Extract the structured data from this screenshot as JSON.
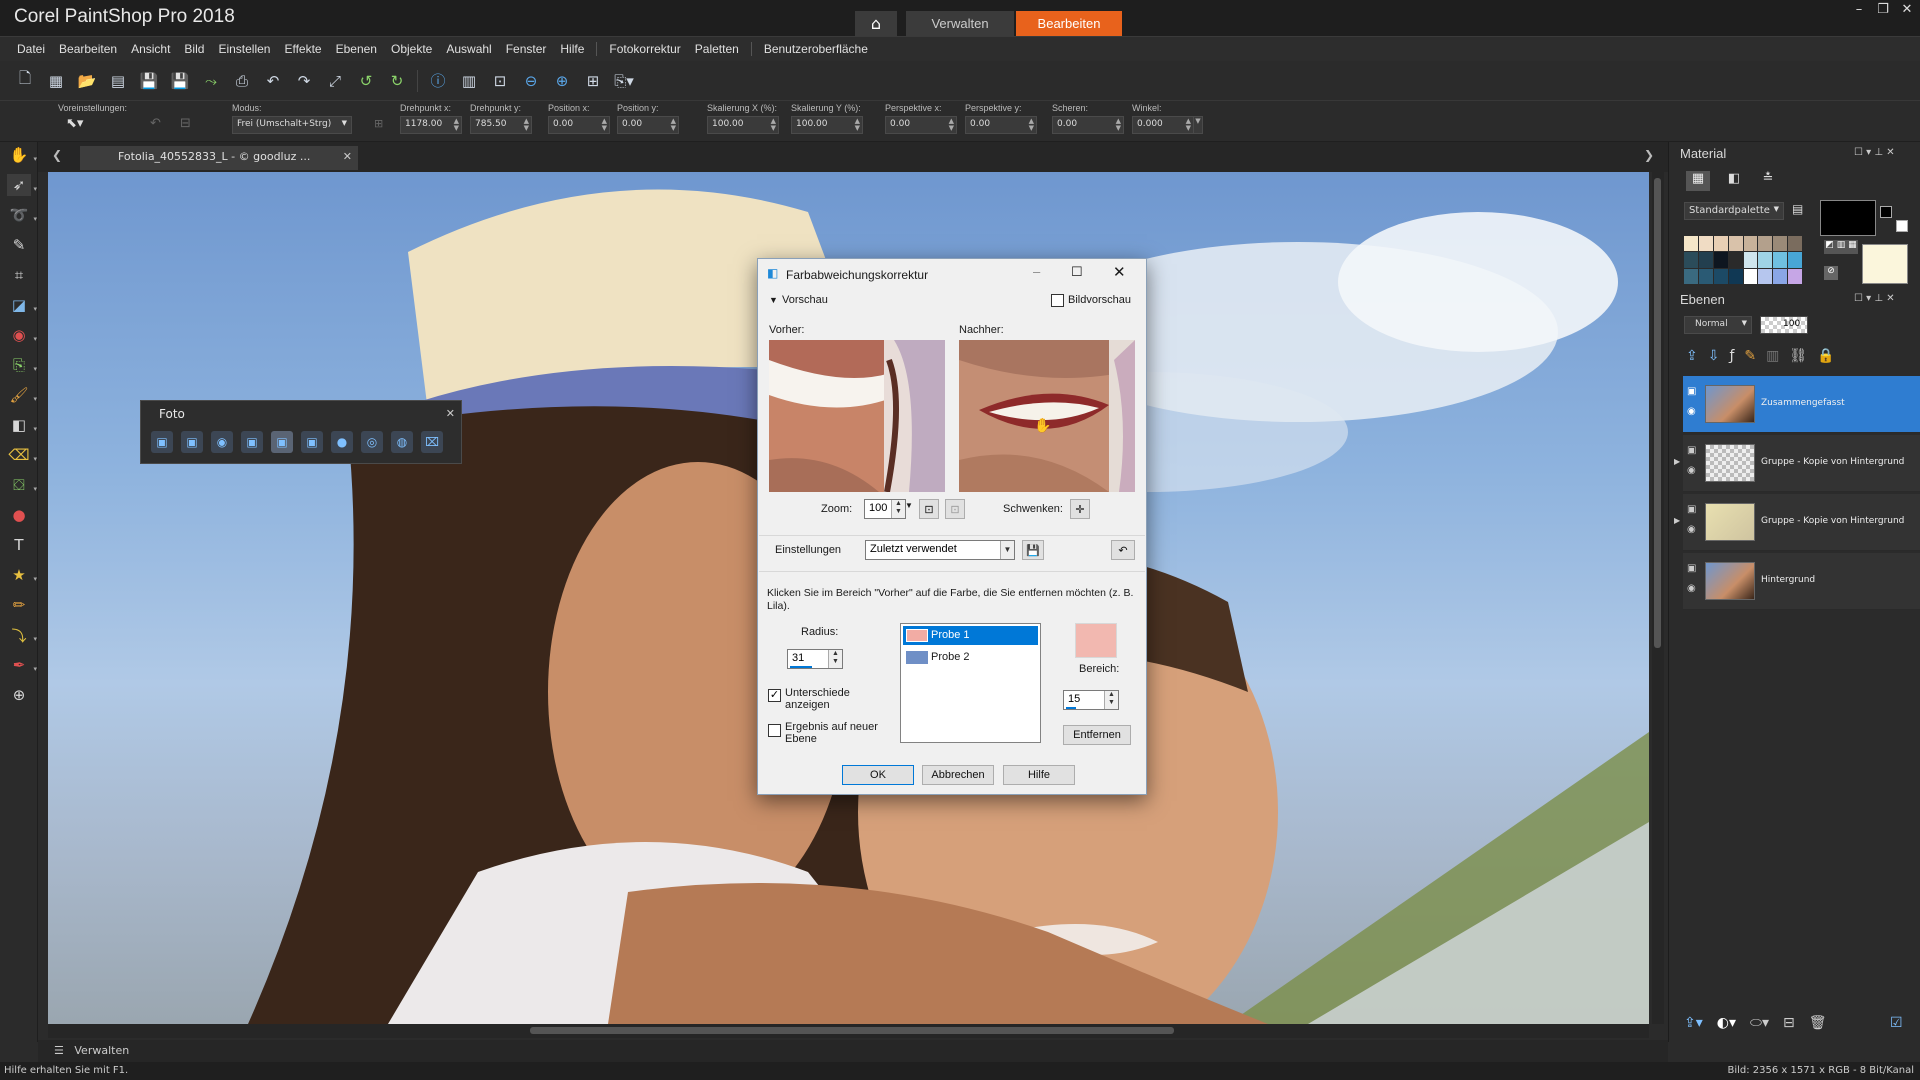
{
  "app": {
    "title": "Corel PaintShop Pro 2018",
    "home_icon": "home-icon"
  },
  "mode_tabs": {
    "manage": "Verwalten",
    "edit": "Bearbeiten"
  },
  "menu": [
    "Datei",
    "Bearbeiten",
    "Ansicht",
    "Bild",
    "Einstellen",
    "Effekte",
    "Ebenen",
    "Objekte",
    "Auswahl",
    "Fenster",
    "Hilfe",
    "Fotokorrektur",
    "Paletten",
    "Benutzeroberfläche"
  ],
  "tool_options": {
    "presets_label": "Voreinstellungen:",
    "mode_label": "Modus:",
    "mode_value": "Frei (Umschalt+Strg)",
    "fields": [
      {
        "label": "Drehpunkt x:",
        "value": "1178.00"
      },
      {
        "label": "Drehpunkt y:",
        "value": "785.50"
      },
      {
        "label": "Position x:",
        "value": "0.00"
      },
      {
        "label": "Position y:",
        "value": "0.00"
      },
      {
        "label": "Skalierung X (%):",
        "value": "100.00"
      },
      {
        "label": "Skalierung Y (%):",
        "value": "100.00"
      },
      {
        "label": "Perspektive x:",
        "value": "0.00"
      },
      {
        "label": "Perspektive y:",
        "value": "0.00"
      },
      {
        "label": "Scheren:",
        "value": "0.00"
      },
      {
        "label": "Winkel:",
        "value": "0.000"
      }
    ]
  },
  "document_tab": {
    "title": "Fotolia_40552833_L - © goodluz ..."
  },
  "foto_palette": {
    "title": "Foto"
  },
  "dialog": {
    "title": "Farbabweichungskorrektur",
    "preview_label": "Vorschau",
    "image_preview_label": "Bildvorschau",
    "before_label": "Vorher:",
    "after_label": "Nachher:",
    "zoom_label": "Zoom:",
    "zoom_value": "100",
    "pan_label": "Schwenken:",
    "settings_label": "Einstellungen",
    "settings_value": "Zuletzt verwendet",
    "instruction": "Klicken Sie im Bereich \"Vorher\" auf die Farbe, die Sie entfernen möchten (z. B. Lila).",
    "radius_label": "Radius:",
    "radius_value": "31",
    "show_diff_label": "Unterschiede anzeigen",
    "new_layer_label": "Ergebnis auf neuer Ebene",
    "samples": [
      {
        "label": "Probe 1",
        "color": "#f2aca4"
      },
      {
        "label": "Probe 2",
        "color": "#6f8fc6"
      }
    ],
    "range_label": "Bereich:",
    "range_value": "15",
    "remove_label": "Entfernen",
    "ok_label": "OK",
    "cancel_label": "Abbrechen",
    "help_label": "Hilfe",
    "swatch_color": "#f2b8b0"
  },
  "material_panel": {
    "title": "Material",
    "palette_select": "Standardpalette"
  },
  "layers_panel": {
    "title": "Ebenen",
    "blend_mode": "Normal",
    "opacity": "100",
    "layers": [
      {
        "name": "Zusammengefasst",
        "selected": true
      },
      {
        "name": "Gruppe - Kopie von Hintergrund",
        "selected": false
      },
      {
        "name": "Gruppe - Kopie von Hintergrund",
        "selected": false
      },
      {
        "name": "Hintergrund",
        "selected": false
      }
    ]
  },
  "bottom": {
    "manage_label": "Verwalten"
  },
  "status": {
    "hint": "Hilfe erhalten Sie mit F1.",
    "image_info": "Bild:  2356 x 1571 x RGB - 8 Bit/Kanal"
  },
  "colors": {
    "accent": "#e8621c",
    "selection": "#2f7dd1"
  }
}
